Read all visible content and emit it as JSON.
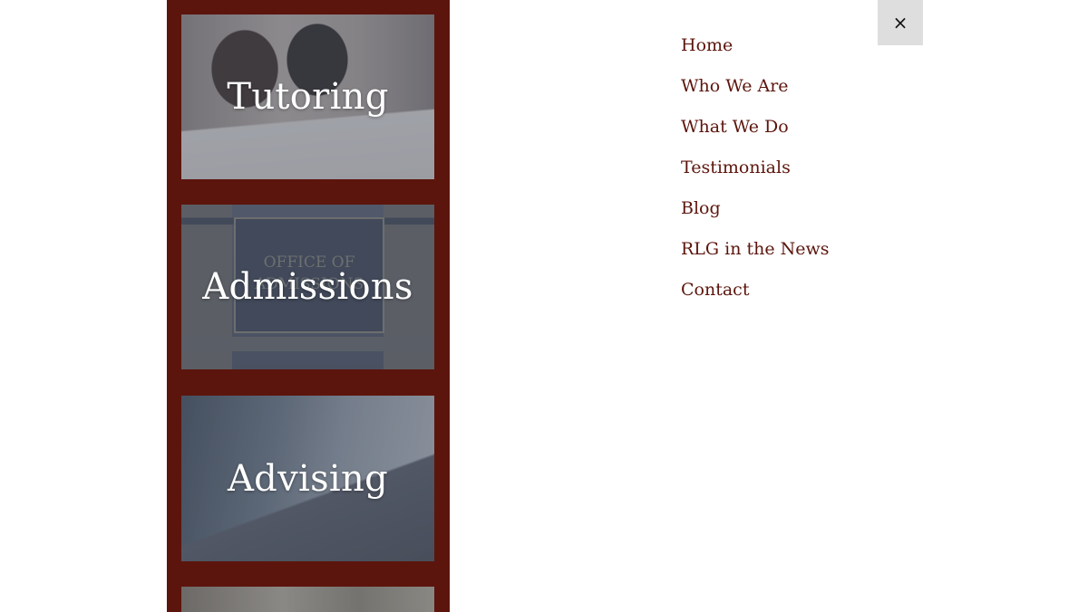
{
  "services": [
    {
      "label": "Tutoring"
    },
    {
      "label": "Admissions",
      "sign_text": "OFFICE OF ADMISSIONS"
    },
    {
      "label": "Advising"
    },
    {
      "label": ""
    }
  ],
  "nav": {
    "items": [
      {
        "label": "Home"
      },
      {
        "label": "Who We Are"
      },
      {
        "label": "What We Do"
      },
      {
        "label": "Testimonials"
      },
      {
        "label": "Blog"
      },
      {
        "label": "RLG in the News"
      },
      {
        "label": "Contact"
      }
    ]
  },
  "close_button": {
    "icon": "close-icon",
    "glyph": "×"
  },
  "colors": {
    "brand_maroon": "#5c150d",
    "nav_text": "#5c150d",
    "close_bg": "#dedede",
    "background": "#ffffff"
  }
}
